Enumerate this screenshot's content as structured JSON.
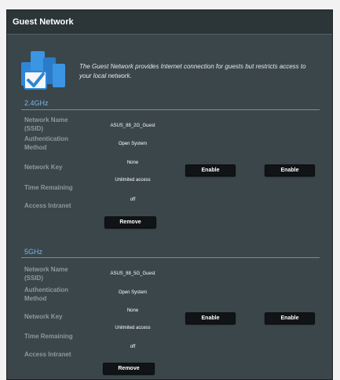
{
  "title": "Guest Network",
  "description": "The Guest Network provides Internet connection for guests but restricts access to your local network.",
  "fields": {
    "ssid": "Network Name (SSID)",
    "auth": "Authentication Method",
    "key": "Network Key",
    "time": "Time Remaining",
    "intranet": "Access Intranet"
  },
  "bands": [
    {
      "label": "2.4GHz",
      "ssid": "ASUS_88_2G_Guest",
      "auth": "Open System",
      "key": "None",
      "time": "Unlimited access",
      "intranet": "off",
      "remove": "Remove",
      "enable_buttons": [
        "Enable",
        "Enable"
      ]
    },
    {
      "label": "5GHz",
      "ssid": "ASUS_88_5G_Guest",
      "auth": "Open System",
      "key": "None",
      "time": "Unlimited access",
      "intranet": "off",
      "remove": "Remove",
      "enable_buttons": [
        "Enable",
        "Enable"
      ]
    }
  ],
  "colors": {
    "panel": "#3a464a",
    "header": "#2c3538",
    "band_label": "#7fb3e8",
    "button": "#111416",
    "icon_blue": "#2f86d6"
  },
  "icons": {
    "hero": "guest-network-devices-icon"
  }
}
